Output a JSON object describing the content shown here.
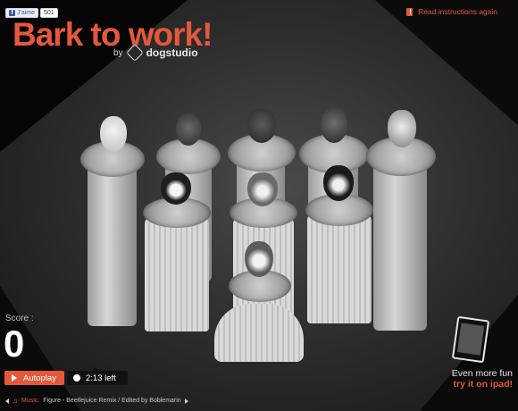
{
  "facebook": {
    "like_label": "J'aime",
    "count": "501"
  },
  "app": {
    "title": "Bark to work!",
    "by": "by",
    "studio": "dogstudio"
  },
  "header": {
    "instructions_label": "Read instructions again"
  },
  "score": {
    "label": "Score :",
    "value": "0"
  },
  "controls": {
    "autoplay_label": "Autoplay",
    "timer_label": "2:13 left"
  },
  "music": {
    "label": "Music:",
    "track": "Figure - Beetlejuice Remix / Edited by Boblemarin"
  },
  "promo": {
    "line1": "Even more fun",
    "line2": "try it on ipad!"
  },
  "colors": {
    "accent": "#e4583b",
    "background": "#2f2f2f"
  },
  "icons": [
    "facebook-icon",
    "book-icon",
    "dogstudio-logo-icon",
    "play-icon",
    "paw-icon",
    "music-note-icon",
    "arrow-left-icon",
    "arrow-right-icon",
    "ipad-icon"
  ]
}
